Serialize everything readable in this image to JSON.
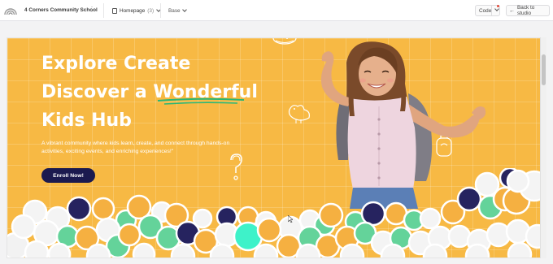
{
  "topbar": {
    "site_name": "4 Corners Community School",
    "page_label": "Homepage",
    "page_count": "(3)",
    "base_label": "Base",
    "code_label": "Code",
    "back_label": "Back to studio"
  },
  "hero": {
    "title_line1": "Explore Create",
    "title_line2_prefix": "Discover a ",
    "title_line2_emph": "Wonderful",
    "title_line3": "Kids Hub",
    "description": "A vibrant community where kids learn, create, and connect through hands-on activities, exciting events, and enriching experiences!\"",
    "cta_label": "Enroll Now!"
  },
  "colors": {
    "hero_bg": "#f7b944",
    "cta_bg": "#1b1a4f",
    "underline": "#2bb673",
    "navy": "#26235f",
    "green": "#64d39a",
    "mint": "#3ef2c9",
    "orange": "#f5b041"
  },
  "icons": [
    "logo-icon",
    "kebab-icon",
    "document-icon",
    "chevron-down-icon",
    "arrow-left-icon",
    "question-doodle-icon",
    "bird-doodle-icon",
    "lantern-doodle-icon",
    "globe-doodle-icon"
  ]
}
